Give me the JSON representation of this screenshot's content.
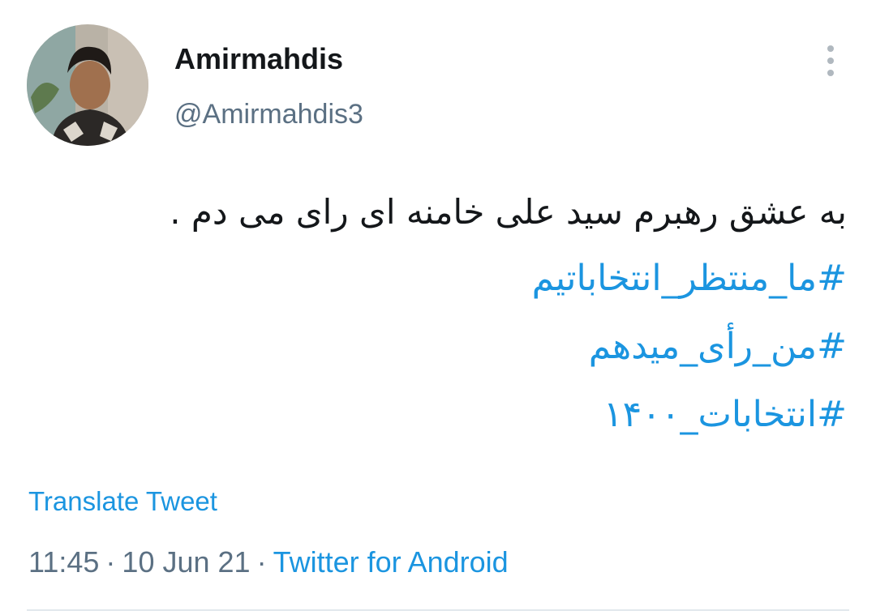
{
  "user": {
    "display_name": "Amirmahdis",
    "handle": "@Amirmahdis3",
    "avatar_icon": "profile-photo"
  },
  "tweet": {
    "text": "به عشق رهبرم سید علی خامنه ای رای می دم .",
    "hashtags": [
      "#ما_منتظر_انتخاباتیم",
      "#من_رأی_میدهم",
      "#انتخابات_۱۴۰۰"
    ]
  },
  "translate_label": "Translate Tweet",
  "meta": {
    "time": "11:45",
    "separator": "·",
    "date": "10 Jun 21",
    "source": "Twitter for Android"
  },
  "colors": {
    "link": "#1b95e0",
    "secondary_text": "#5b7083",
    "primary_text": "#14171a",
    "divider": "#e1e8ed"
  }
}
